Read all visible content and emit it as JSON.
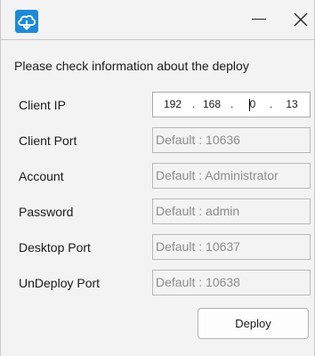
{
  "window": {
    "icon": "cloud-download-icon",
    "minimize_icon": "minimize-icon",
    "close_icon": "close-icon"
  },
  "heading": "Please check information about the deploy",
  "form": {
    "client_ip": {
      "label": "Client IP",
      "octets": [
        "192",
        "168",
        "0",
        "13"
      ],
      "separator": "."
    },
    "client_port": {
      "label": "Client Port",
      "placeholder": "Default : 10636"
    },
    "account": {
      "label": "Account",
      "placeholder": "Default : Administrator"
    },
    "password": {
      "label": "Password",
      "placeholder": "Default : admin"
    },
    "desktop_port": {
      "label": "Desktop Port",
      "placeholder": "Default : 10637"
    },
    "undeploy_port": {
      "label": "UnDeploy Port",
      "placeholder": "Default : 10638"
    }
  },
  "deploy_button": {
    "label": "Deploy"
  },
  "colors": {
    "app_icon_bg": "#1e8ad6",
    "window_bg": "#f3f3f3",
    "field_border": "#b8b8b8"
  }
}
